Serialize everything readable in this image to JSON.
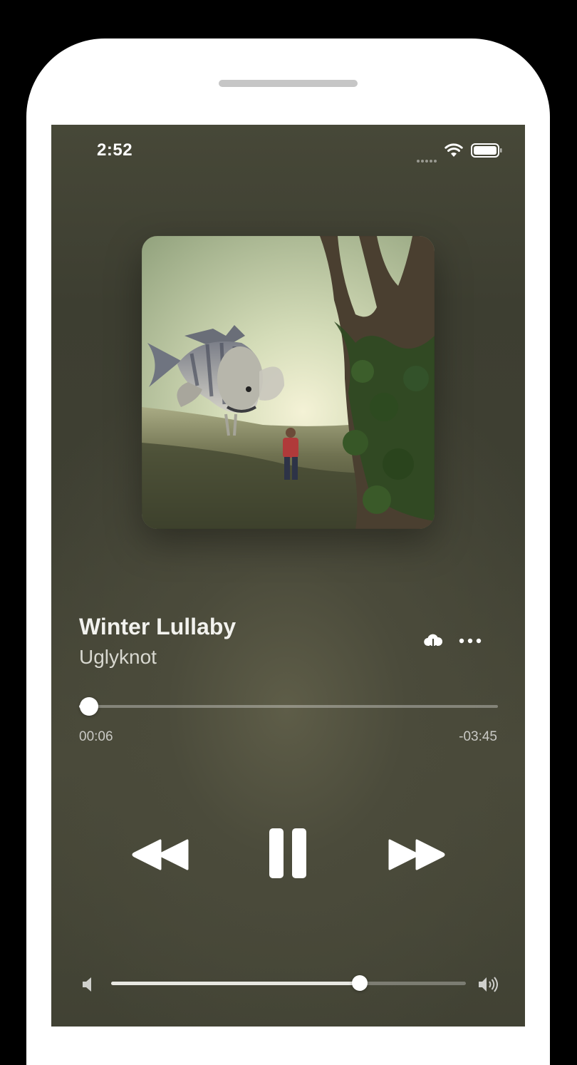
{
  "status_bar": {
    "time": "2:52",
    "icons": [
      "signal-dots-icon",
      "wifi-icon",
      "battery-icon"
    ]
  },
  "now_playing": {
    "title": "Winter Lullaby",
    "artist": "Uglyknot",
    "album_art_icon": "album-artwork",
    "actions": [
      "download-icon",
      "more-icon"
    ]
  },
  "playback": {
    "elapsed": "00:06",
    "remaining": "-03:45",
    "progress_fraction": 0.024,
    "state": "playing",
    "controls": [
      "rewind-icon",
      "pause-icon",
      "fast-forward-icon"
    ]
  },
  "volume": {
    "level_fraction": 0.7,
    "icons": [
      "volume-low-icon",
      "volume-high-icon"
    ]
  },
  "colors": {
    "screen_background": "#444536",
    "frame": "#ffffff",
    "outer_background": "#000000",
    "accent": "#ffffff"
  }
}
